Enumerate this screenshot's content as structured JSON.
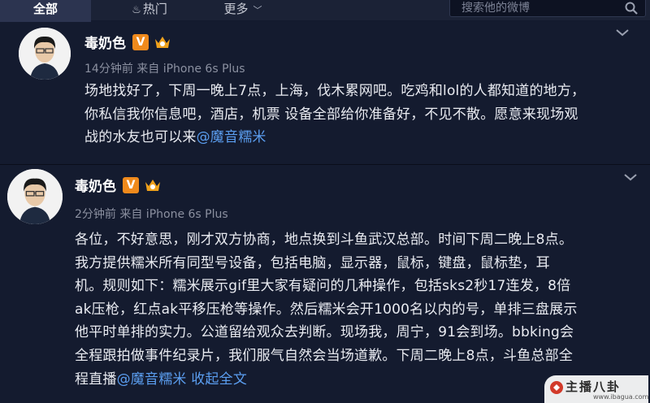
{
  "tabs": [
    {
      "label": "全部"
    },
    {
      "label": "热门"
    },
    {
      "label": "更多"
    }
  ],
  "search": {
    "placeholder": "搜索他的微博"
  },
  "colors": {
    "background": "#141b2f",
    "link": "#5b9ef0",
    "verified_badge": "#f08a1c"
  },
  "posts": [
    {
      "user": {
        "name": "毒奶色",
        "verified_label": "V"
      },
      "meta": "14分钟前 来自 iPhone 6s Plus",
      "lines": [
        "场地找好了，下周一晚上7点，上海，伐木累网吧。吃鸡和lol的人都知道的地方，",
        "你私信我你信息吧，酒店，机票 设备全部给你准备好，不见不散。愿意来现场观",
        "战的水友也可以来"
      ],
      "mention": "@魔音糯米"
    },
    {
      "user": {
        "name": "毒奶色",
        "verified_label": "V"
      },
      "meta": "2分钟前 来自 iPhone 6s Plus",
      "lines": [
        "各位，不好意思，刚才双方协商，地点换到斗鱼武汉总部。时间下周二晚上8点。",
        "我方提供糯米所有同型号设备，包括电脑，显示器，鼠标，键盘，鼠标垫，耳",
        "机。规则如下：糯米展示gif里大家有疑问的几种操作，包括sks2秒17连发，8倍",
        "ak压枪，红点ak平移压枪等操作。然后糯米会开1000名以内的号，单排三盘展示",
        "他平时单排的实力。公道留给观众去判断。现场我，周宁，91会到场。bbking会",
        "全程跟拍做事件纪录片，我们服气自然会当场道歉。下周二晚上8点，斗鱼总部全",
        "程直播"
      ],
      "mention": "@魔音糯米",
      "expand_label": "收起全文"
    }
  ],
  "watermark": {
    "text": "主播八卦",
    "site": "www.ibagua.com"
  }
}
